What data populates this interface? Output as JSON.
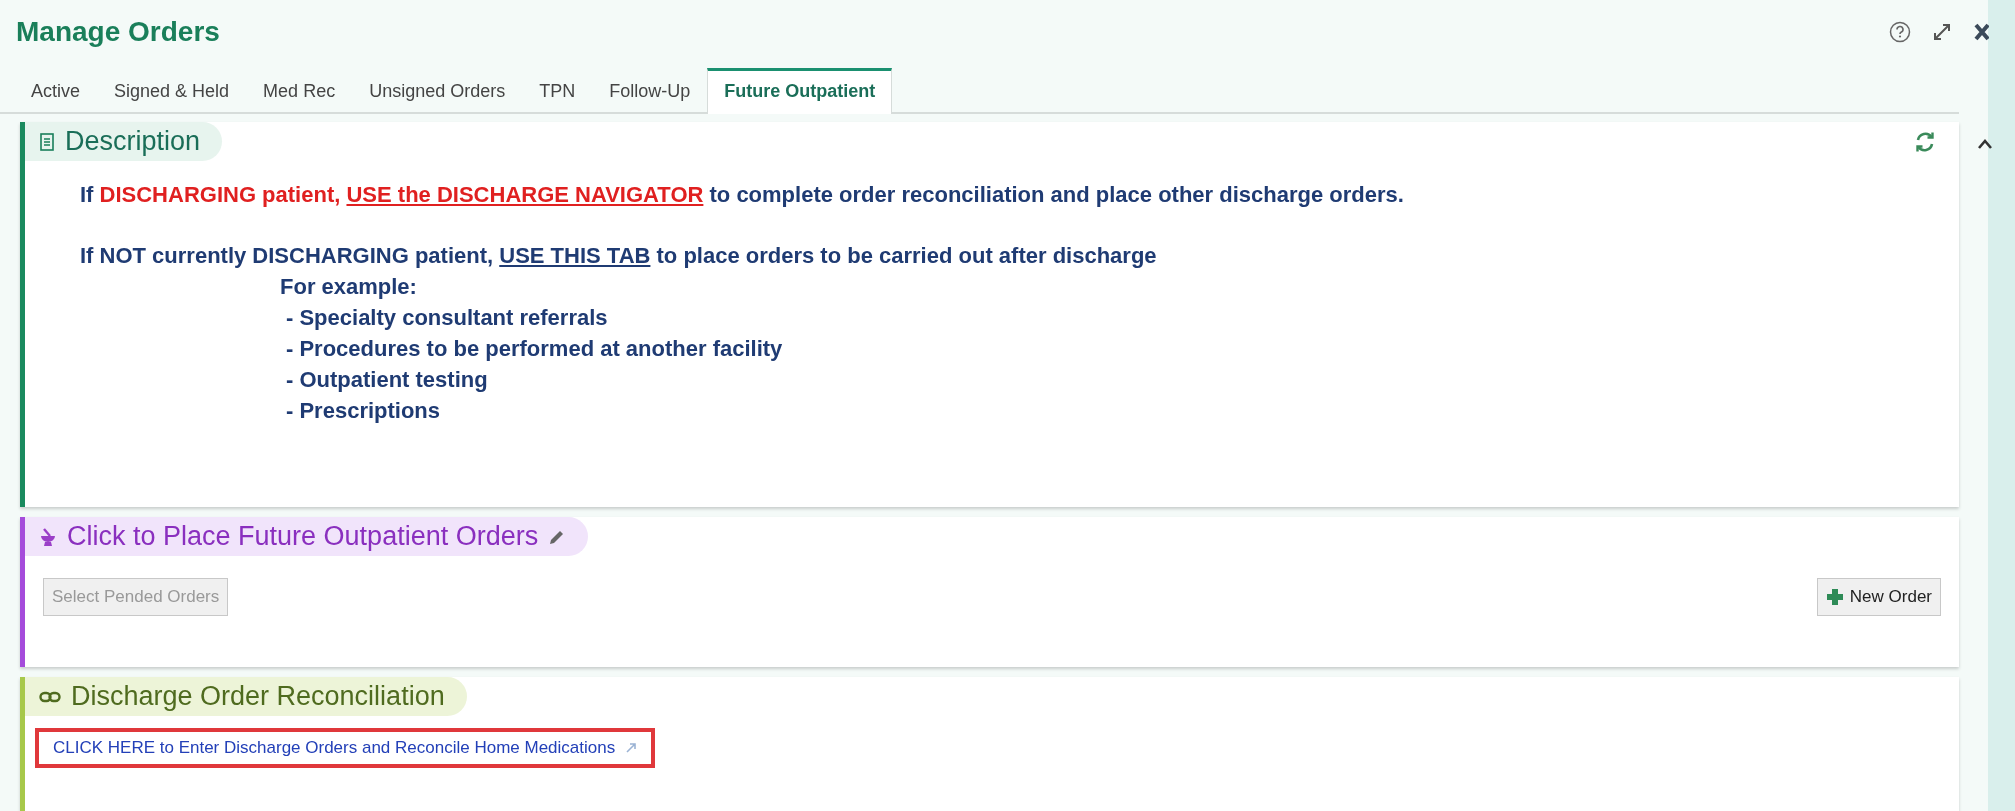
{
  "title": "Manage Orders",
  "tabs": [
    {
      "label": "Active",
      "selected": false
    },
    {
      "label": "Signed & Held",
      "selected": false
    },
    {
      "label": "Med Rec",
      "selected": false
    },
    {
      "label": "Unsigned Orders",
      "selected": false
    },
    {
      "label": "TPN",
      "selected": false
    },
    {
      "label": "Follow-Up",
      "selected": false
    },
    {
      "label": "Future Outpatient",
      "selected": true
    }
  ],
  "description": {
    "title": "Description",
    "lines": [
      {
        "kind": "para",
        "segments": [
          {
            "kind": "plain",
            "text": "If "
          },
          {
            "kind": "alert",
            "text": "DISCHARGING patient, "
          },
          {
            "kind": "alert-link",
            "text": "USE the DISCHARGE NAVIGATOR"
          },
          {
            "kind": "plain",
            "text": " to complete order reconciliation and place other discharge orders."
          }
        ]
      },
      {
        "kind": "para",
        "segments": [
          {
            "kind": "plain",
            "text": "If NOT currently DISCHARGING patient, "
          },
          {
            "kind": "link",
            "text": "USE THIS TAB"
          },
          {
            "kind": "plain",
            "text": " to place orders to be carried out after discharge"
          }
        ]
      },
      {
        "kind": "sub",
        "segments": [
          {
            "kind": "plain",
            "text": "For example:"
          }
        ]
      },
      {
        "kind": "item",
        "segments": [
          {
            "kind": "plain",
            "text": "- Specialty consultant referrals"
          }
        ]
      },
      {
        "kind": "item",
        "segments": [
          {
            "kind": "plain",
            "text": "- Procedures to be performed at another facility"
          }
        ]
      },
      {
        "kind": "item",
        "segments": [
          {
            "kind": "plain",
            "text": "- Outpatient testing"
          }
        ]
      },
      {
        "kind": "item",
        "segments": [
          {
            "kind": "plain",
            "text": "- Prescriptions"
          }
        ]
      }
    ]
  },
  "future_orders": {
    "title": "Click to Place Future Outpatient Orders",
    "select_button": {
      "label": "Select Pended Orders",
      "disabled": true
    },
    "new_button": {
      "label": "New Order",
      "disabled": false
    }
  },
  "reconciliation": {
    "title": "Discharge Order Reconciliation",
    "link": {
      "label": "CLICK HERE to Enter Discharge Orders and Reconcile Home Medications",
      "highlighted": true
    }
  }
}
